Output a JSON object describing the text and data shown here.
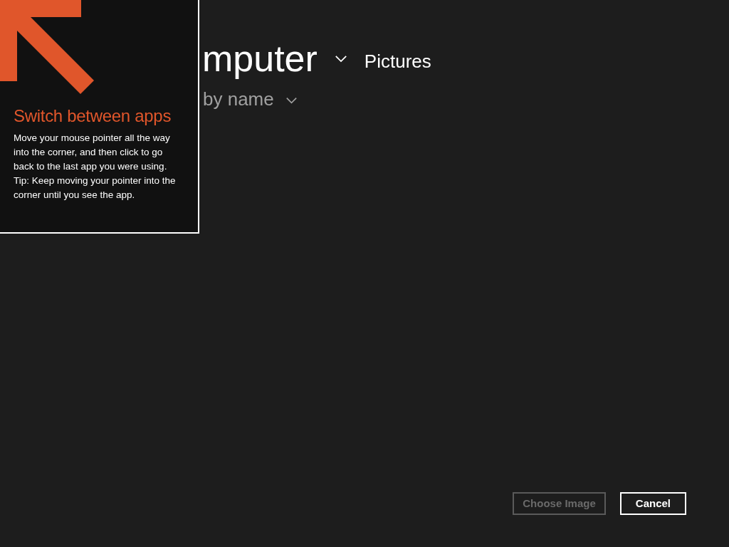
{
  "header": {
    "location": "mputer",
    "folder": "Pictures"
  },
  "sort": {
    "label": "by name"
  },
  "tip": {
    "title": "Switch between apps",
    "paragraphs": [
      "Move your mouse pointer all the way into the corner, and then click to go back to the last app you were using.",
      "Tip: Keep moving your pointer into the corner until you see the app."
    ]
  },
  "buttons": [
    {
      "label": "Choose Image",
      "disabled": true
    },
    {
      "label": "Cancel",
      "disabled": false
    }
  ]
}
